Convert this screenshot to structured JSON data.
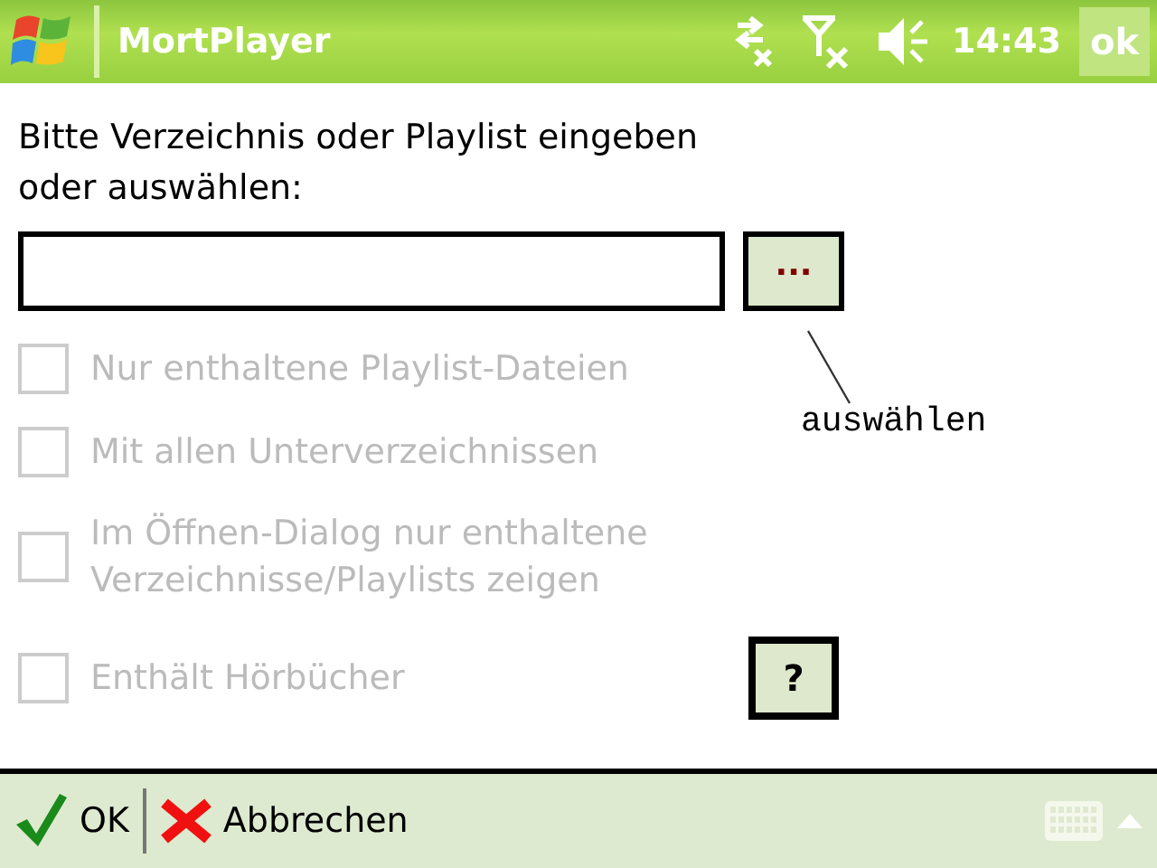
{
  "title_bar": {
    "app_title": "MortPlayer",
    "time": "14:43",
    "ok_button": "ok"
  },
  "prompt": "Bitte Verzeichnis oder Playlist eingeben oder auswählen:",
  "browse_button": "...",
  "annotation": "auswählen",
  "options": [
    {
      "label": "Nur enthaltene Playlist-Dateien",
      "checked": false,
      "disabled": true
    },
    {
      "label": "Mit allen Unterverzeichnissen",
      "checked": false,
      "disabled": true
    },
    {
      "label": "Im Öffnen-Dialog nur enthaltene Verzeichnisse/Playlists zeigen",
      "checked": false,
      "disabled": true
    },
    {
      "label": "Enthält Hörbücher",
      "checked": false,
      "disabled": true
    }
  ],
  "help_button": "?",
  "menu_bar": {
    "ok": "OK",
    "cancel": "Abbrechen"
  }
}
